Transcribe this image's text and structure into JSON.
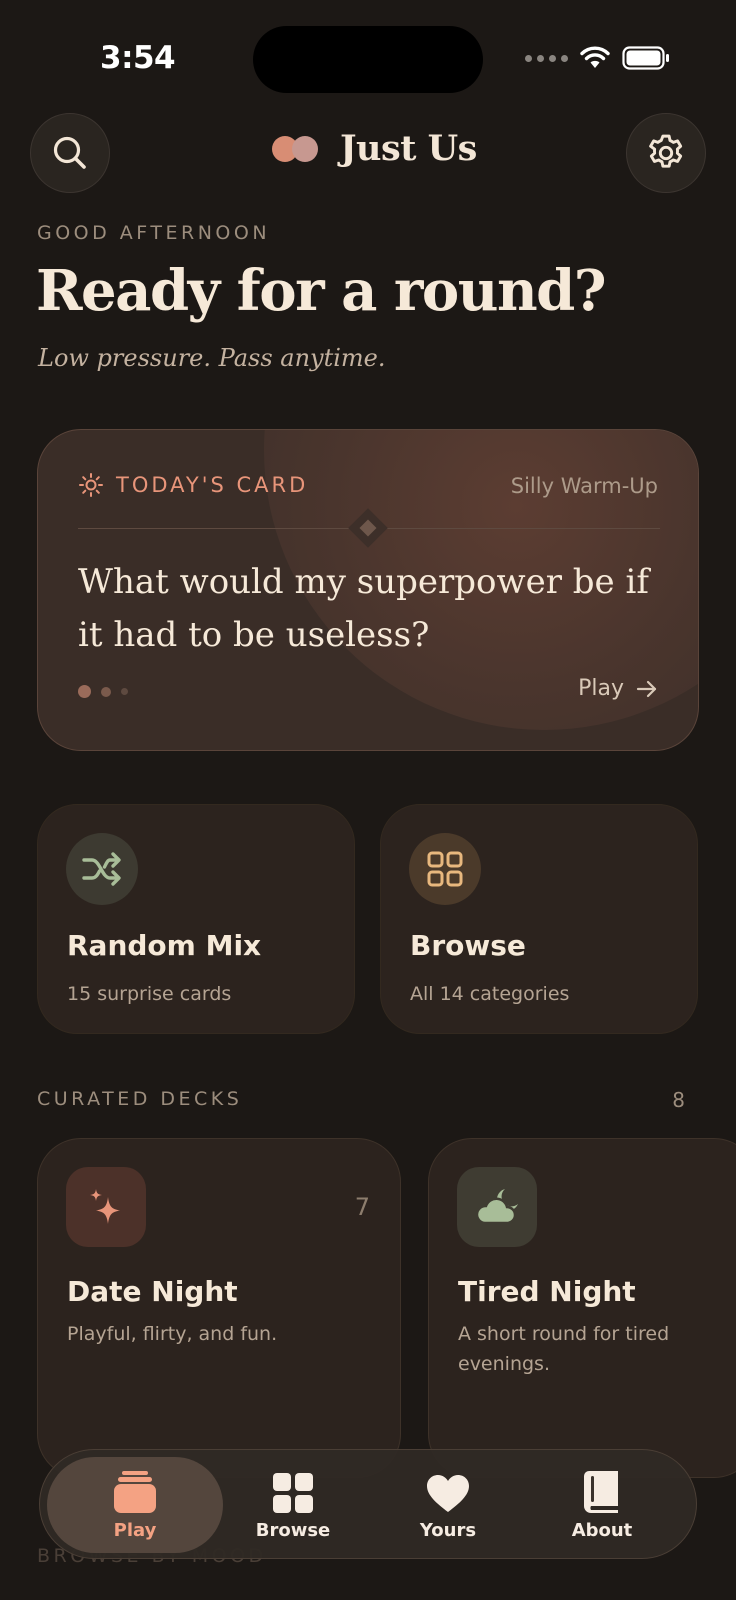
{
  "status": {
    "time": "3:54"
  },
  "header": {
    "title": "Just Us"
  },
  "greeting": {
    "eyebrow": "GOOD AFTERNOON",
    "title": "Ready for a round?",
    "subtitle": "Low pressure. Pass anytime."
  },
  "today_card": {
    "label": "TODAY'S CARD",
    "category": "Silly Warm-Up",
    "question": "What would my superpower be if it had to be useless?",
    "action": "Play"
  },
  "quick_actions": [
    {
      "title": "Random Mix",
      "subtitle": "15 surprise cards"
    },
    {
      "title": "Browse",
      "subtitle": "All 14 categories"
    }
  ],
  "curated": {
    "title": "CURATED DECKS",
    "count": "8",
    "decks": [
      {
        "title": "Date Night",
        "subtitle": "Playful, flirty, and fun.",
        "count": "7"
      },
      {
        "title": "Tired Night",
        "subtitle": "A short round for tired evenings."
      }
    ]
  },
  "next_section": {
    "title": "BROWSE BY MOOD"
  },
  "tabs": [
    {
      "label": "Play",
      "active": true
    },
    {
      "label": "Browse",
      "active": false
    },
    {
      "label": "Yours",
      "active": false
    },
    {
      "label": "About",
      "active": false
    }
  ],
  "colors": {
    "background": "#1c1815",
    "accent": "#e8957a",
    "text": "#f6e9d8",
    "muted": "#9c8d7d"
  }
}
